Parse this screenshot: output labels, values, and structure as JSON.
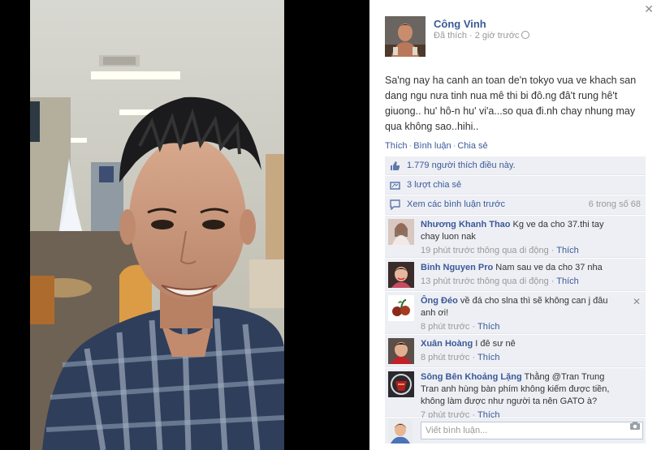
{
  "post": {
    "author": "Công Vinh",
    "meta_time": "Đã thích · 2 giờ trước",
    "text": "Sa'ng nay ha canh an toan de'n tokyo vua ve khach san dang ngu nưa tinh nua mê thi bi đô.ng đâ't rung hê't giuong.. hu' hô-n hu' vi'a...so qua đi.nh chay nhung may qua không sao..hihi.."
  },
  "actions": {
    "like": "Thích",
    "comment": "Bình luận",
    "share": "Chia sẻ"
  },
  "stats": {
    "likes": "1.779 người thích điều này.",
    "shares": "3 lượt chia sẻ",
    "view_previous": "Xem các bình luận trước",
    "count": "6 trong số 68"
  },
  "comments": [
    {
      "name": "Nhương Khanh Thao",
      "text": " Kg ve da cho 37.thi tay chay luon nak",
      "meta": "19 phút trước thông qua di động · ",
      "like": "Thích"
    },
    {
      "name": "Binh Nguyen Pro",
      "text": " Nam sau ve da cho 37 nha",
      "meta": "13 phút trước thông qua di động · ",
      "like": "Thích"
    },
    {
      "name": "Ông Đéo",
      "text": " về đá cho slna thì sẽ không can j đâu anh ơi!",
      "meta": "8 phút trước · ",
      "like": "Thích"
    },
    {
      "name": "Xuân Hoàng",
      "text": " I đê sư nê",
      "meta": "8 phút trước · ",
      "like": "Thích"
    },
    {
      "name": "Sông Bên Khoảng Lặng",
      "text": " Thằng @Tran Trung Tran anh hùng bàn phím không kiếm được tiền, không làm được như người ta nên GATO à?",
      "meta": "7 phút trước · ",
      "like": "Thích"
    }
  ],
  "composer": {
    "placeholder": "Viết bình luận..."
  },
  "icons": {
    "close": "close-icon",
    "globe": "globe-icon",
    "like": "thumbs-up-icon",
    "share": "share-icon",
    "comment": "comment-bubble-icon",
    "camera": "camera-icon"
  },
  "colors": {
    "link": "#3b5998",
    "ufi_bg": "#edeff4",
    "muted": "#999999"
  }
}
